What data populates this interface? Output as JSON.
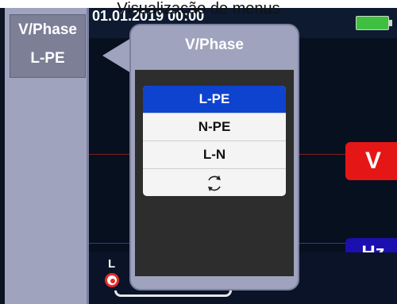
{
  "caption": "Visualização de menus",
  "sidebar": {
    "button_line1": "V/Phase",
    "button_line2": "L-PE"
  },
  "topbar": {
    "datetime": "01.01.2019 00:00",
    "battery_icon": "battery-full-icon"
  },
  "popup": {
    "title": "V/Phase",
    "items": [
      {
        "label": "L-PE",
        "selected": true
      },
      {
        "label": "N-PE",
        "selected": false
      },
      {
        "label": "L-N",
        "selected": false
      },
      {
        "label": "",
        "icon": "rotate-cycle-icon",
        "selected": false
      }
    ]
  },
  "measurement": {
    "voltage_badge": "V",
    "frequency_badge": "Hz",
    "connection_label": "L"
  },
  "colors": {
    "panel": "#9fa3bd",
    "selected": "#0e43cf",
    "voltage": "#e51616",
    "frequency": "#1c0fb0"
  }
}
